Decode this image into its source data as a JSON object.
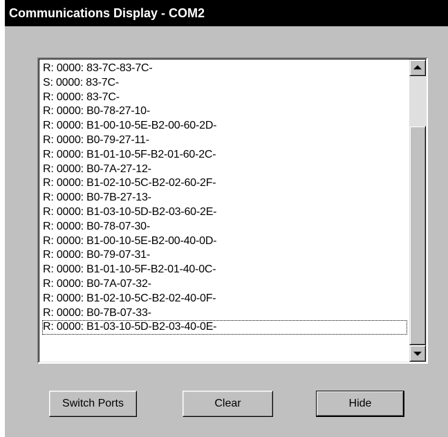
{
  "window": {
    "title": "Communications Display - COM2"
  },
  "log": {
    "lines": [
      "R:  0000: 83-7C-83-7C-",
      "S:  0000: 83-7C-",
      "R:  0000: 83-7C-",
      "R:  0000: B0-78-27-10-",
      "R:  0000: B1-00-10-5E-B2-00-60-2D-",
      "R:  0000: B0-79-27-11-",
      "R:  0000: B1-01-10-5F-B2-01-60-2C-",
      "R:  0000: B0-7A-27-12-",
      "R:  0000: B1-02-10-5C-B2-02-60-2F-",
      "R:  0000: B0-7B-27-13-",
      "R:  0000: B1-03-10-5D-B2-03-60-2E-",
      "R:  0000: B0-78-07-30-",
      "R:  0000: B1-00-10-5E-B2-00-40-0D-",
      "R:  0000: B0-79-07-31-",
      "R:  0000: B1-01-10-5F-B2-01-40-0C-",
      "R:  0000: B0-7A-07-32-",
      "R:  0000: B1-02-10-5C-B2-02-40-0F-",
      "R:  0000: B0-7B-07-33-",
      "R:  0000: B1-03-10-5D-B2-03-40-0E-"
    ],
    "focused_index": 18
  },
  "scrollbar": {
    "up_icon": "scroll-up-arrow-icon",
    "down_icon": "scroll-down-arrow-icon"
  },
  "buttons": {
    "switch_ports": "Switch Ports",
    "clear": "Clear",
    "hide": "Hide"
  },
  "colors": {
    "title_bar": "#000000",
    "title_text": "#ffffff",
    "window_face": "#c0c0c0",
    "list_background": "#ffffff"
  }
}
